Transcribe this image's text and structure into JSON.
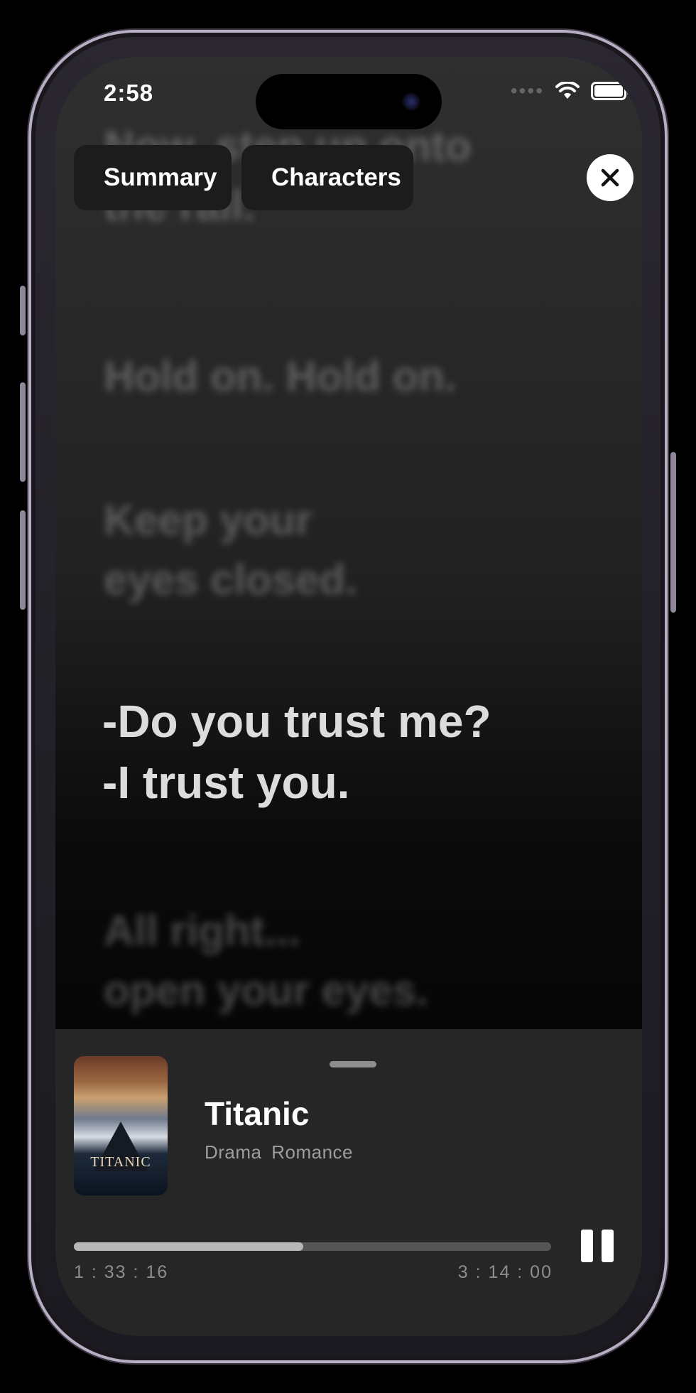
{
  "status_bar": {
    "time": "2:58",
    "signal_icon": "signal-dots-icon",
    "wifi_icon": "wifi-icon",
    "battery_icon": "battery-icon"
  },
  "chips": [
    {
      "label": "Summary",
      "icon": "sparkles-icon"
    },
    {
      "label": "Characters",
      "icon": "sparkles-icon"
    }
  ],
  "close_icon": "close-icon",
  "lyrics": [
    {
      "line1": "Now, step up onto",
      "line2": "the rail."
    },
    {
      "line1": "Hold on. Hold on.",
      "line2": ""
    },
    {
      "line1": "Keep your",
      "line2": "eyes closed."
    },
    {
      "line1": "-Do you trust me?",
      "line2": "-I trust you."
    },
    {
      "line1": "All right...",
      "line2": "open your eyes."
    }
  ],
  "player": {
    "title": "Titanic",
    "genres": "Drama  Romance",
    "poster_text": "TITANIC",
    "elapsed": "1 : 33 : 16",
    "duration": "3 : 14 : 00",
    "progress_fraction": 0.48,
    "pause_icon": "pause-icon"
  }
}
